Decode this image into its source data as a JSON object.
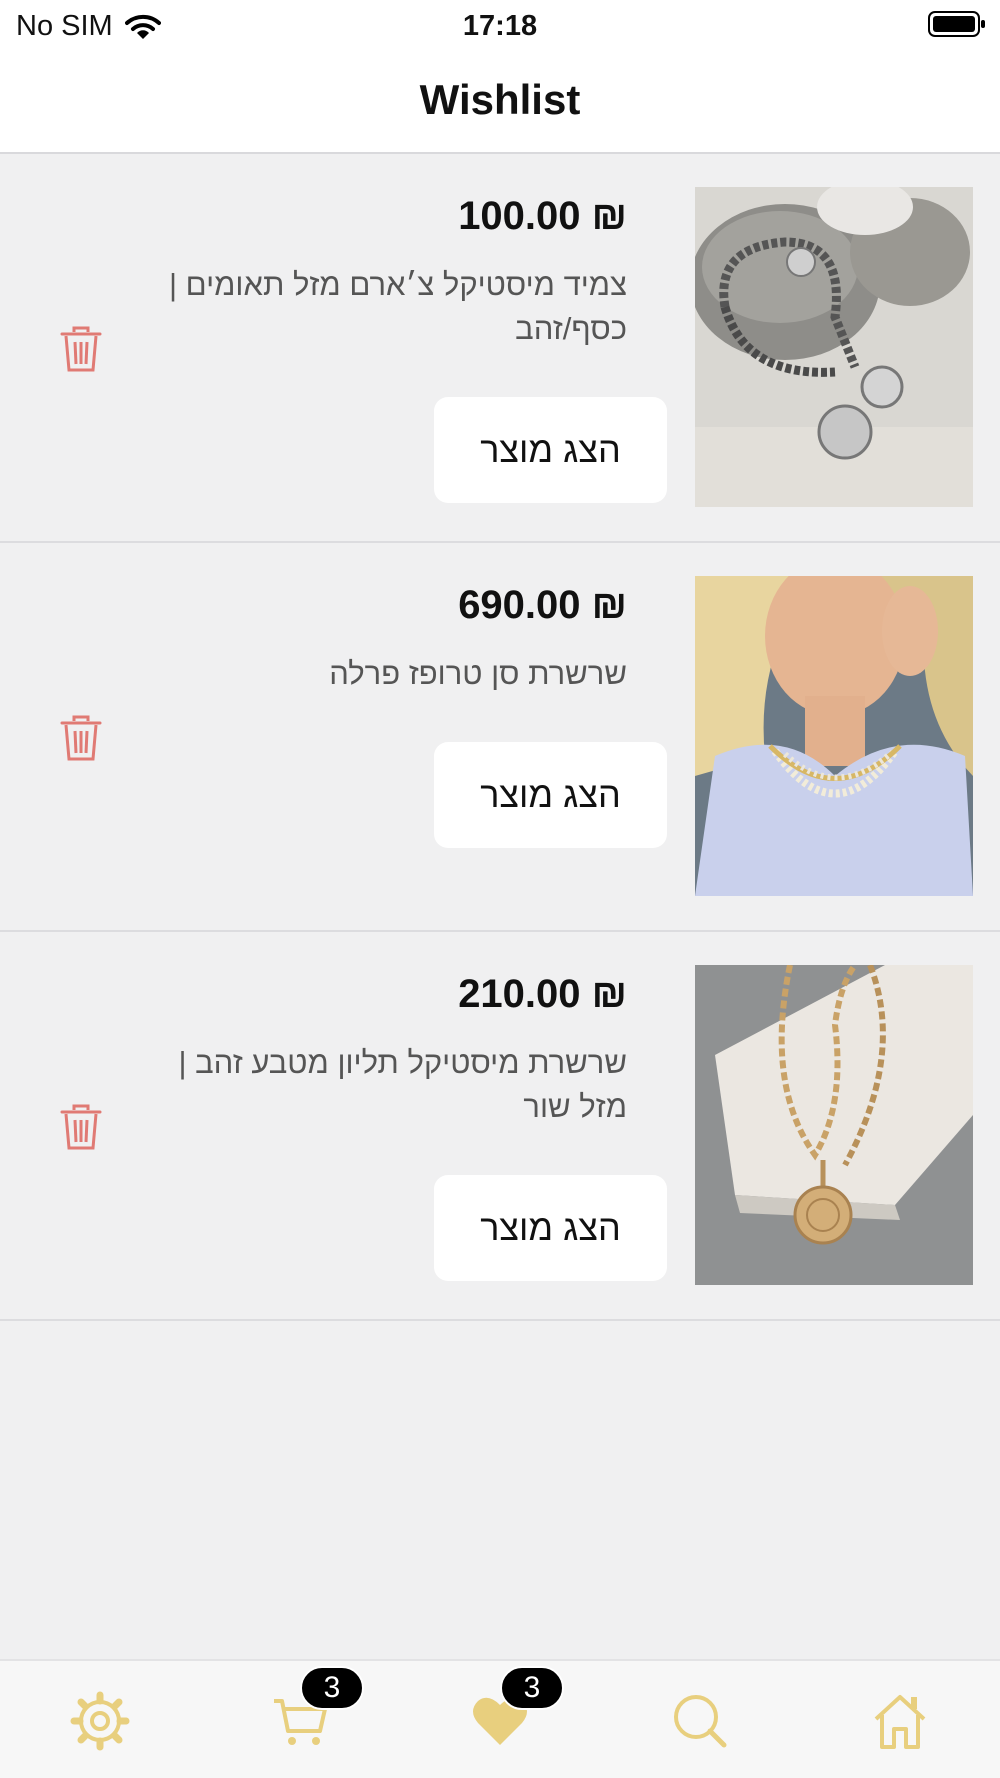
{
  "status_bar": {
    "carrier": "No SIM",
    "time": "17:18"
  },
  "header": {
    "title": "Wishlist"
  },
  "wishlist": {
    "items": [
      {
        "price": "₪ 100.00",
        "name": "צמיד מיסטיקל צ׳ארם מזל תאומים | כסף/זהב",
        "button_label": "הצג מוצר"
      },
      {
        "price": "₪ 690.00",
        "name": "שרשרת סן טרופז פרלה",
        "button_label": "הצג מוצר"
      },
      {
        "price": "₪ 210.00",
        "name": "שרשרת מיסטיקל תליון מטבע זהב | מזל שור",
        "button_label": "הצג מוצר"
      }
    ]
  },
  "tab_bar": {
    "cart_badge": "3",
    "wishlist_badge": "3",
    "accent_color": "#e8cf7e",
    "icons": [
      "settings-icon",
      "cart-icon",
      "heart-icon",
      "search-icon",
      "home-icon"
    ]
  },
  "colors": {
    "delete_icon": "#e07a74",
    "background": "#f0f0f1"
  }
}
